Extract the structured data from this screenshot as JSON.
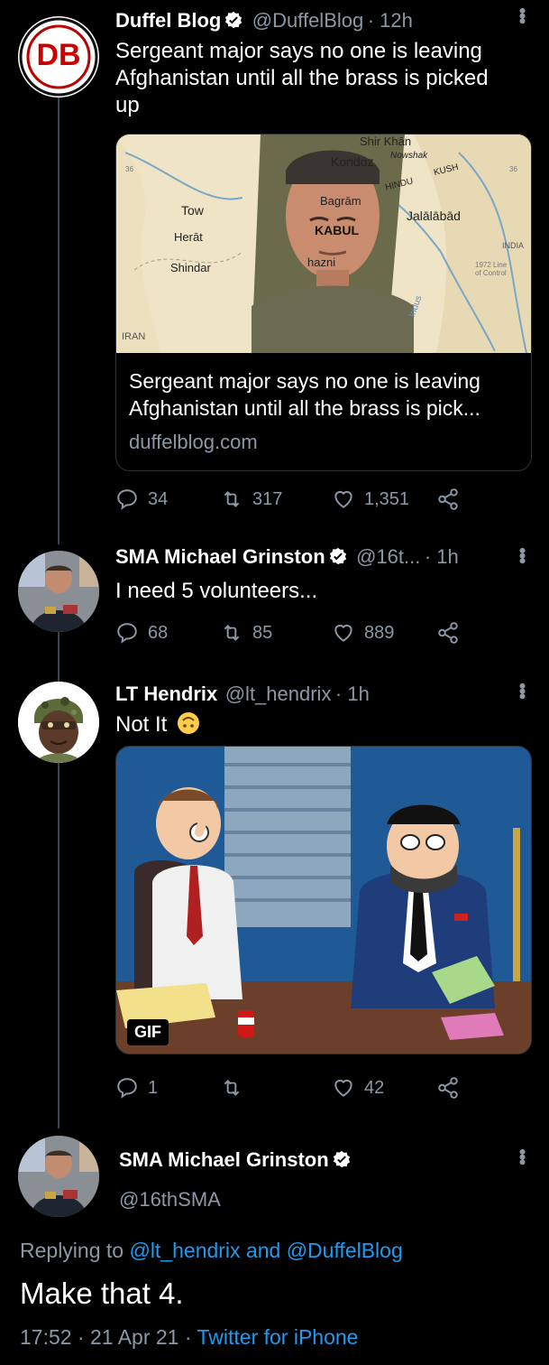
{
  "tweet1": {
    "avatar_text": "DB",
    "name": "Duffel Blog",
    "handle": "@DuffelBlog",
    "time": "· 12h",
    "text_line1": "Sergeant major says no one is leaving",
    "text_line2": "Afghanistan until all the brass is picked",
    "text_line3": "up",
    "card": {
      "map_labels": [
        "Shir Khān",
        "Kondoz",
        "Nowshak",
        "HINDU",
        "KUSH",
        "Bagrām",
        "Tow",
        "Herāt",
        "KABUL",
        "Jalālābād",
        "Shindar",
        "hazni",
        "IRAN",
        "INDIA",
        "1972 Line of Control",
        "Indus",
        "36",
        "36"
      ],
      "title_line1": "Sergeant major says no one is leaving",
      "title_line2": "Afghanistan until all the brass is pick...",
      "domain": "duffelblog.com"
    },
    "replies": "34",
    "retweets": "317",
    "likes": "1,351"
  },
  "tweet2": {
    "name": "SMA Michael Grinston",
    "handle": "@16t...",
    "time": "· 1h",
    "text": "I need 5 volunteers...",
    "replies": "68",
    "retweets": "85",
    "likes": "889"
  },
  "tweet3": {
    "name": "LT Hendrix",
    "handle": "@lt_hendrix",
    "time": "· 1h",
    "text": "Not It",
    "gif_label": "GIF",
    "replies": "1",
    "retweets": "",
    "likes": "42"
  },
  "tweet4": {
    "name": "SMA Michael Grinston",
    "handle": "@16thSMA",
    "replying_prefix": "Replying to",
    "replying_user1": "@lt_hendrix",
    "replying_and": "and",
    "replying_user2": "@DuffelBlog",
    "text": "Make that 4.",
    "meta_time": "17:52 · 21 Apr 21 ·",
    "meta_source": "Twitter for iPhone"
  },
  "colors": {
    "accent": "#1d9bf0",
    "verified": "#ffffff",
    "background": "#000000"
  }
}
